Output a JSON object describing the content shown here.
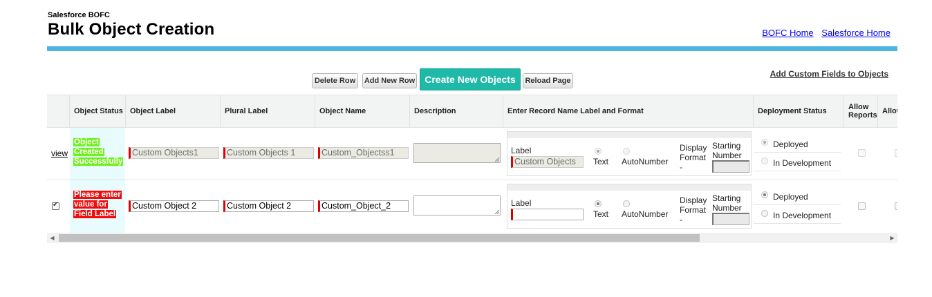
{
  "header": {
    "app_name": "Salesforce BOFC",
    "title": "Bulk Object Creation",
    "links": [
      "BOFC Home",
      "Salesforce Home"
    ]
  },
  "toolbar": {
    "delete_row": "Delete Row",
    "add_new_row": "Add New Row",
    "create_new_objects": "Create New Objects",
    "reload_page": "Reload Page",
    "add_custom_fields": "Add Custom Fields to Objects"
  },
  "columns": [
    "Object Status",
    "Object Label",
    "Plural Label",
    "Object Name",
    "Description",
    "Enter Record Name Label and Format",
    "Deployment Status",
    "Allow Reports",
    "Allow Acti"
  ],
  "record_name_labels": {
    "label": "Label",
    "text": "Text",
    "autonumber": "AutoNumber",
    "display_format": "Display Format",
    "display_dash": "-",
    "starting_number": "Starting Number"
  },
  "deployment_options": {
    "deployed": "Deployed",
    "in_development": "In Development"
  },
  "rows": [
    {
      "action": "view",
      "status": [
        "Object",
        "Created",
        "Successfully"
      ],
      "status_color": "#6ef01a",
      "object_label": "Custom Objects1",
      "plural_label": "Custom Objects 1",
      "object_name": "Custom_Objectss1",
      "record_label": "Custom Objects",
      "disabled": true
    },
    {
      "action": "checked",
      "status": [
        "Please enter",
        "value for",
        "Field Label"
      ],
      "status_color": "#f00c0c",
      "object_label": "Custom Object 2",
      "plural_label": "Custom Object 2",
      "object_name": "Custom_Object_2",
      "record_label": "",
      "disabled": false
    }
  ],
  "colors": {
    "accent_bar": "#4db5e2",
    "primary_button": "#1fb9a8"
  }
}
